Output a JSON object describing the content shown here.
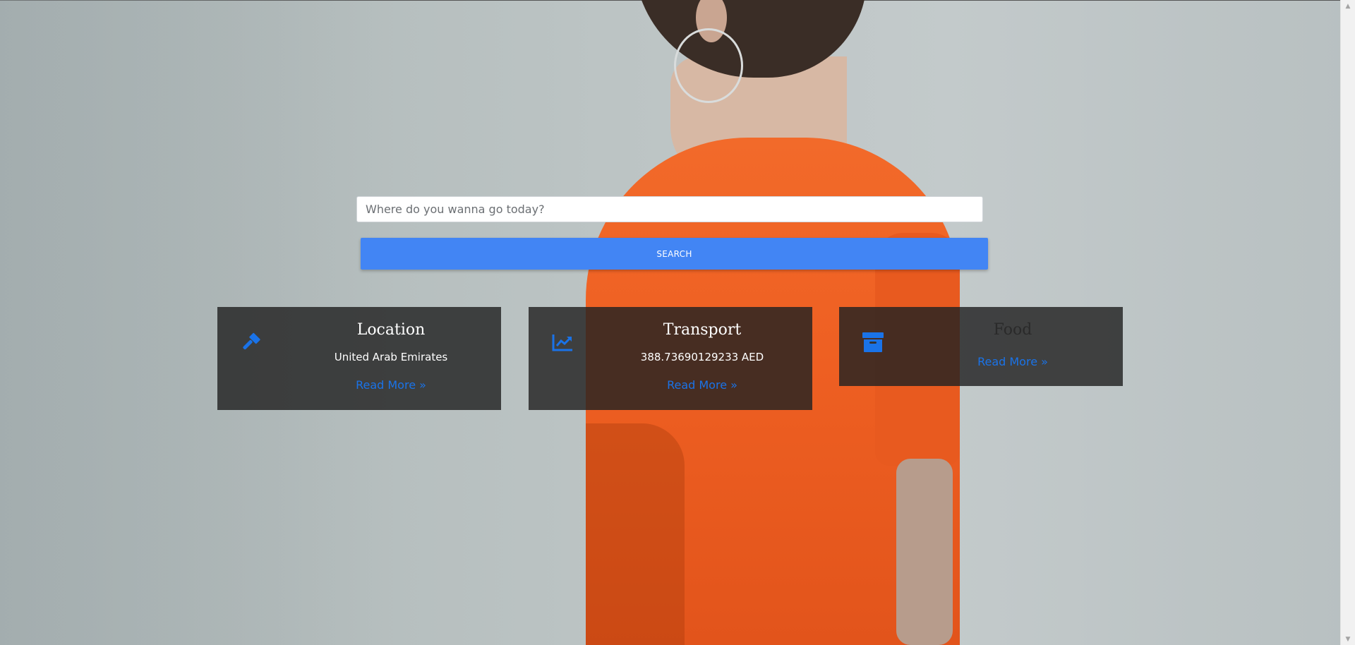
{
  "search": {
    "placeholder": "Where do you wanna go today?",
    "button_label": "SEARCH"
  },
  "cards": [
    {
      "title": "Location",
      "value": "United Arab Emirates",
      "link": "Read More »",
      "icon": "hammer-icon"
    },
    {
      "title": "Transport",
      "value": "388.73690129233 AED",
      "link": "Read More »",
      "icon": "chart-line-icon"
    },
    {
      "title": "Food",
      "link": "Read More »",
      "icon": "archive-icon"
    }
  ],
  "colors": {
    "accent": "#4285f4",
    "link": "#1a73e8",
    "icon": "#1a73e8",
    "card_bg": "#222222"
  },
  "scrollbar": {
    "up_arrow": "▲",
    "down_arrow": "▼"
  }
}
